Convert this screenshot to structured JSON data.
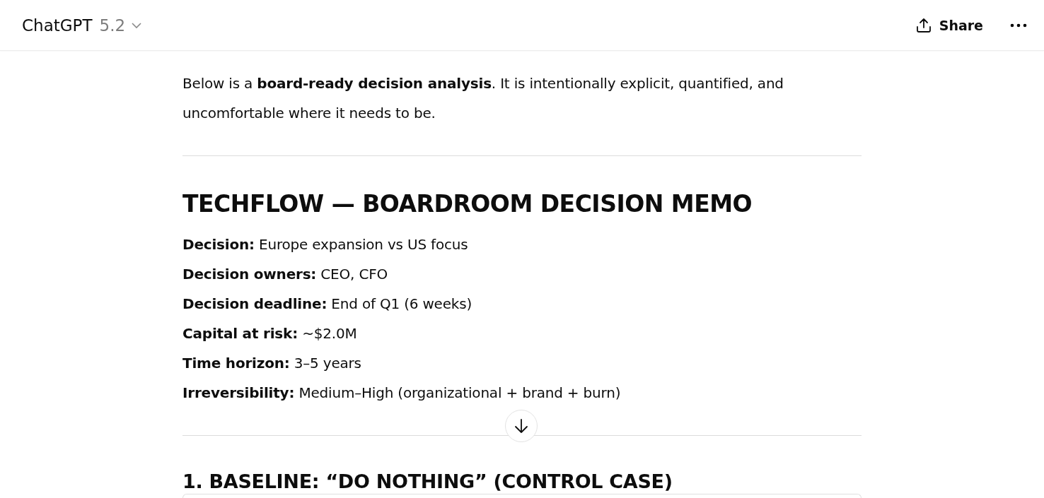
{
  "header": {
    "title": "ChatGPT",
    "version": "5.2",
    "share": "Share"
  },
  "intro": "Below is a **board-ready decision analysis**. It is intentionally explicit, quantified, and uncomfortable where it needs to be.",
  "memo_title": "TECHFLOW — BOARDROOM DECISION MEMO",
  "fields": [
    {
      "label": "Decision:",
      "value": "Europe expansion vs US focus"
    },
    {
      "label": "Decision owners:",
      "value": "CEO, CFO"
    },
    {
      "label": "Decision deadline:",
      "value": "End of Q1 (6 weeks)"
    },
    {
      "label": "Capital at risk:",
      "value": "~$2.0M"
    },
    {
      "label": "Time horizon:",
      "value": "3–5 years"
    },
    {
      "label": "Irreversibility:",
      "value": "Medium–High (organizational + brand + burn)"
    }
  ],
  "section_heading": "1. BASELINE: “DO NOTHING” (CONTROL CASE)"
}
